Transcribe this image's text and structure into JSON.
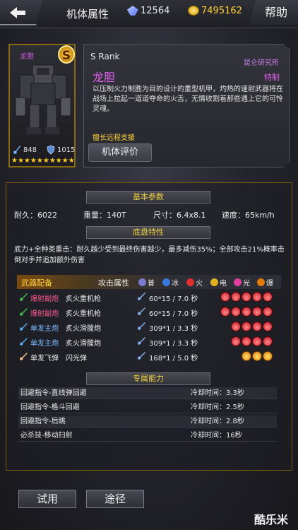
{
  "header": {
    "title": "机体属性",
    "crystal_value": "12564",
    "gold_value": "7495162",
    "help_label": "帮助"
  },
  "portrait": {
    "name": "龙胆",
    "rank_badge": "S",
    "attack": "848",
    "defense": "1015",
    "star_count": 10
  },
  "info": {
    "rank": "S  Rank",
    "lab": "昆仑研究所",
    "name": "龙胆",
    "tag": "特制",
    "description": "以压制火力制胜为目的设计的重型机甲，灼热的速射武器将在战场上拉起一道道夺命的火舌，无情收割着那些遇上它的可怜灵魂。",
    "role": "擅长远程支援",
    "eval_button": "机体评价"
  },
  "sections": {
    "basic": "基本参数",
    "chassis": "底盘特性",
    "special": "专属能力"
  },
  "basic_params": {
    "durability": "耐久：6022",
    "weight": "重量：140T",
    "size": "尺寸：6.4x8.1",
    "speed": "速度：65km/h"
  },
  "chassis_desc": "底力+全种类重击：耐久越少受到最终伤害越少，最多减伤35%；全部攻击21%概率击倒对手并追加额外伤害",
  "weapons": {
    "title": "武器配备",
    "attr_label": "攻击属性",
    "legend": [
      "普",
      "冰",
      "火",
      "电",
      "光",
      "爆"
    ],
    "legend_colors": [
      "#7a7ad0",
      "#3a7ae0",
      "#e03030",
      "#e0b020",
      "#e040a0",
      "#e07a00"
    ],
    "rows": [
      {
        "type": "爆射副炮",
        "name": "炙火重机枪",
        "stat": "60*15 / 7.0 秒",
        "elem": "fire",
        "count": 5,
        "type_color": "pink",
        "icon_color": "#4ac050"
      },
      {
        "type": "爆射副炮",
        "name": "炙火重机枪",
        "stat": "60*15 / 7.0 秒",
        "elem": "fire",
        "count": 5,
        "type_color": "pink",
        "icon_color": "#4ac050"
      },
      {
        "type": "单发主炮",
        "name": "炙火滑膛炮",
        "stat": "309*1 / 3.3 秒",
        "elem": "fire",
        "count": 4,
        "type_color": "blue",
        "icon_color": "#5ab0f0"
      },
      {
        "type": "单发主炮",
        "name": "炙火滑膛炮",
        "stat": "309*1 / 3.3 秒",
        "elem": "fire",
        "count": 4,
        "type_color": "blue",
        "icon_color": "#5ab0f0"
      },
      {
        "type": "单发飞弹",
        "name": "闪光弹",
        "stat": "168*1 / 5.0 秒",
        "elem": "blast",
        "count": 3,
        "type_color": "white",
        "icon_color": "#f0c890"
      }
    ]
  },
  "skills": [
    {
      "name": "回避指令-直线弹回避",
      "cooldown": "冷却时间：3.3秒"
    },
    {
      "name": "回避指令-格斗回避",
      "cooldown": "冷却时间：2.5秒"
    },
    {
      "name": "回避指令-后跳",
      "cooldown": "冷却时间：2.8秒"
    },
    {
      "name": "必杀技-移动扫射",
      "cooldown": "冷却时间：16秒"
    }
  ],
  "buttons": {
    "try": "试用",
    "source": "途径"
  },
  "watermark": "酷乐米"
}
